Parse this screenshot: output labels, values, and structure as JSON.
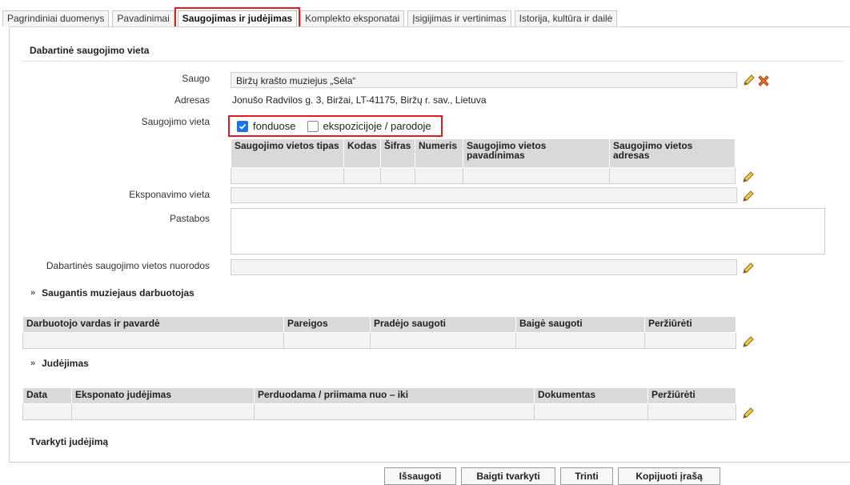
{
  "tabs": [
    {
      "label": "Pagrindiniai duomenys"
    },
    {
      "label": "Pavadinimai"
    },
    {
      "label": "Saugojimas ir judėjimas"
    },
    {
      "label": "Komplekto eksponatai"
    },
    {
      "label": "Įsigijimas ir vertinimas"
    },
    {
      "label": "Istorija, kultūra ir dailė"
    }
  ],
  "current": {
    "title": "Dabartinė saugojimo vieta",
    "saugo_label": "Saugo",
    "saugo_value": "Biržų krašto muziejus „Sėla“",
    "adresas_label": "Adresas",
    "adresas_value": "Jonušo Radvilos g. 3, Biržai, LT-41175, Biržų r. sav., Lietuva",
    "vieta_label": "Saugojimo vieta",
    "opt_fonduose": "fonduose",
    "opt_ekspozicijoje": "ekspozicijoje / parodoje",
    "storage_headers": [
      "Saugojimo vietos tipas",
      "Kodas",
      "Šifras",
      "Numeris",
      "Saugojimo vietos pavadinimas",
      "Saugojimo vietos adresas"
    ],
    "eksponavimo_label": "Eksponavimo vieta",
    "pastabos_label": "Pastabos",
    "nuorodos_label": "Dabartinės saugojimo vietos nuorodos"
  },
  "staff": {
    "title": "Saugantis muziejaus darbuotojas",
    "headers": [
      "Darbuotojo vardas ir pavardė",
      "Pareigos",
      "Pradėjo saugoti",
      "Baigė saugoti",
      "Peržiūrėti"
    ]
  },
  "movement": {
    "title": "Judėjimas",
    "headers": [
      "Data",
      "Eksponato judėjimas",
      "Perduodama / priimama nuo – iki",
      "Dokumentas",
      "Peržiūrėti"
    ]
  },
  "manage_movement": "Tvarkyti judėjimą",
  "buttons": {
    "save": "Išsaugoti",
    "finish": "Baigti tvarkyti",
    "delete": "Trinti",
    "copy": "Kopijuoti įrašą"
  },
  "colors": {
    "highlight": "#e01b24",
    "checkbox": "#1a73e8",
    "header_bg": "#d9d9d9"
  },
  "icons": [
    "edit-icon",
    "delete-icon",
    "chevron-down-icon"
  ]
}
